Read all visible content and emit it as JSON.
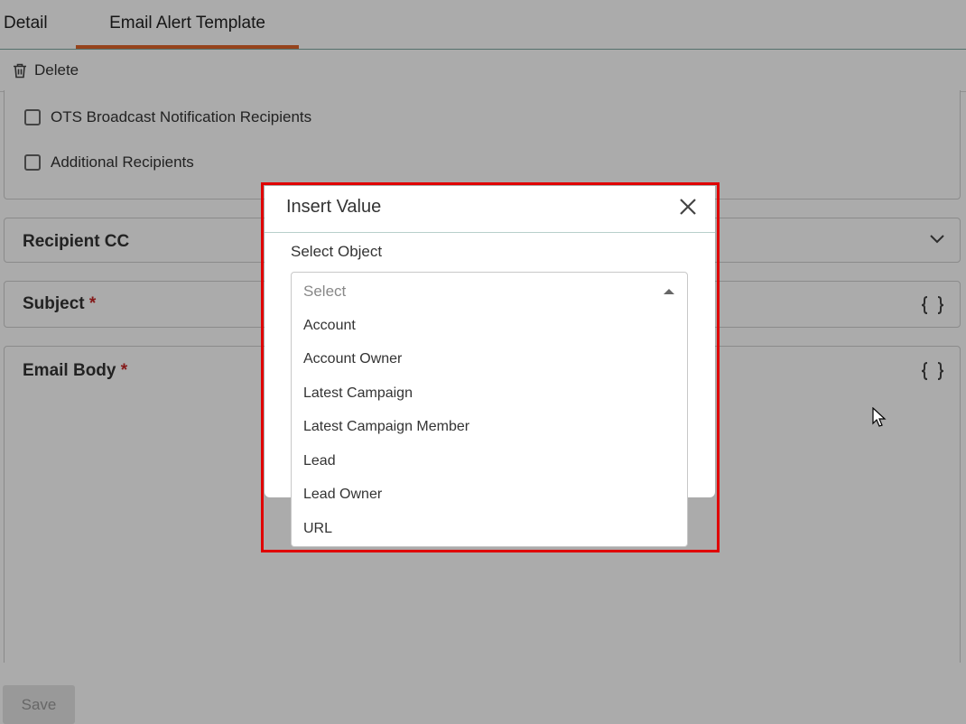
{
  "tabs": {
    "detail": "Detail",
    "email_alert_template": "Email Alert Template"
  },
  "toolbar": {
    "delete_label": "Delete"
  },
  "recipients": {
    "items": [
      {
        "label": "OTS Broadcast Notification Recipients",
        "checked": false
      },
      {
        "label": "Additional Recipients",
        "checked": false
      }
    ]
  },
  "sections": {
    "recipient_cc": "Recipient CC",
    "subject": "Subject",
    "email_body": "Email Body",
    "required_marker": "*"
  },
  "footer": {
    "save_label": "Save"
  },
  "modal": {
    "title": "Insert Value",
    "select_object_label": "Select Object",
    "select_placeholder": "Select",
    "options": [
      "Account",
      "Account Owner",
      "Latest Campaign",
      "Latest Campaign Member",
      "Lead",
      "Lead Owner",
      "URL"
    ]
  },
  "colors": {
    "tab_accent": "#e0642a",
    "highlight_border": "#e00000",
    "required": "#c62828"
  },
  "icons": [
    "trash-icon",
    "chevron-down-icon",
    "curly-braces-icon",
    "close-icon",
    "caret-up-icon",
    "mouse-cursor-icon"
  ]
}
